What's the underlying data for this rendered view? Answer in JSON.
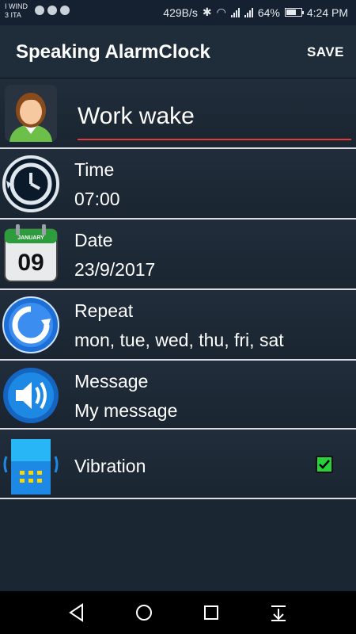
{
  "status": {
    "carrier_line1": "I WIND",
    "carrier_line2": "3 ITA",
    "speed": "429B/s",
    "battery": "64%",
    "time": "4:24 PM"
  },
  "appbar": {
    "title": "Speaking AlarmClock",
    "save_label": "SAVE"
  },
  "alarm": {
    "name": "Work wake",
    "time_label": "Time",
    "time_value": "07:00",
    "date_label": "Date",
    "date_value": "23/9/2017",
    "calendar_month": "JANUARY",
    "calendar_day": "09",
    "repeat_label": "Repeat",
    "repeat_value": "mon, tue, wed, thu, fri, sat",
    "message_label": "Message",
    "message_value": "My message",
    "vibration_label": "Vibration",
    "vibration_checked": true
  },
  "colors": {
    "background": "#1b2633",
    "appbar": "#1f2c3a",
    "accent_underline": "#e53935",
    "checkbox": "#28d13a"
  },
  "icons": [
    "avatar-icon",
    "clock-icon",
    "calendar-icon",
    "repeat-icon",
    "speaker-icon",
    "phone-vibrate-icon",
    "back-icon",
    "home-icon",
    "recents-icon",
    "notifications-icon"
  ]
}
